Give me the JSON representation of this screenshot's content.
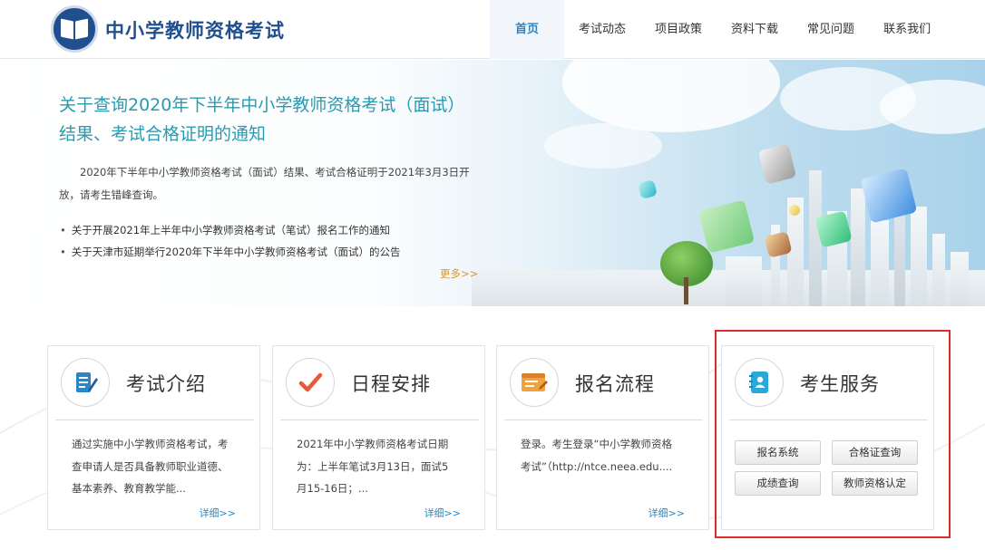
{
  "header": {
    "site_title": "中小学教师资格考试",
    "nav": [
      "首页",
      "考试动态",
      "项目政策",
      "资料下载",
      "常见问题",
      "联系我们"
    ]
  },
  "banner": {
    "headline": "关于查询2020年下半年中小学教师资格考试（面试）结果、考试合格证明的通知",
    "summary": "2020年下半年中小学教师资格考试（面试）结果、考试合格证明于2021年3月3日开放，请考生错峰查询。",
    "news": [
      "关于开展2021年上半年中小学教师资格考试（笔试）报名工作的通知",
      "关于天津市延期举行2020年下半年中小学教师资格考试（面试）的公告"
    ],
    "more": "更多>>"
  },
  "cards": [
    {
      "title": "考试介绍",
      "icon": "document-pen-icon",
      "text": "通过实施中小学教师资格考试，考查申请人是否具备教师职业道德、基本素养、教育教学能...",
      "more": "详细>>"
    },
    {
      "title": "日程安排",
      "icon": "checkmark-icon",
      "text": "2021年中小学教师资格考试日期为：上半年笔试3月13日，面试5月15-16日；...",
      "more": "详细>>"
    },
    {
      "title": "报名流程",
      "icon": "browser-form-icon",
      "text": "登录。考生登录“中小学教师资格考试”（http://ntce.neea.edu....",
      "more": "详细>>"
    }
  ],
  "service": {
    "title": "考生服务",
    "icon": "contact-book-icon",
    "buttons": [
      "报名系统",
      "合格证查询",
      "成绩查询",
      "教师资格认定"
    ]
  },
  "colors": {
    "brand_blue": "#1f4f8f",
    "nav_active": "#2a86c8",
    "headline_teal": "#2a9ab0",
    "more_orange": "#e0962b",
    "highlight_red": "#e02b2b"
  }
}
